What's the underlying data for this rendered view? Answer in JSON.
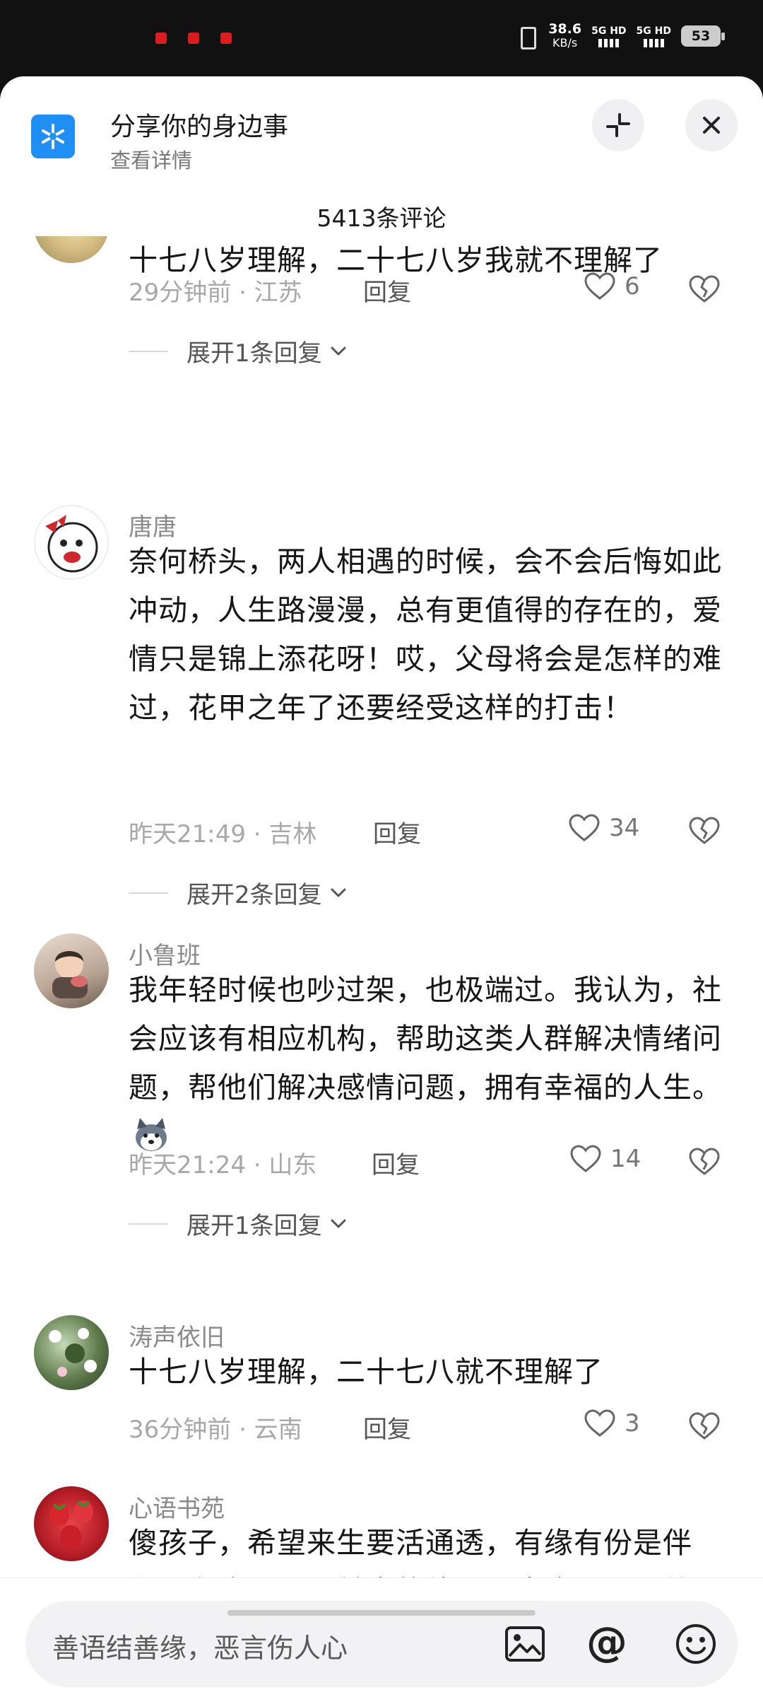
{
  "status_bar": {
    "speed": "38.6",
    "speed_unit": "KB/s",
    "sim1": "5G HD",
    "sim2": "5G HD",
    "battery": "53"
  },
  "header": {
    "topic_title": "分享你的身边事",
    "topic_sub": "查看详情",
    "comment_count": "5413条评论"
  },
  "comments": [
    {
      "username": "",
      "text": "十七八岁理解，二十七八岁我就不理解了",
      "meta": "29分钟前 · 江苏",
      "reply_label": "回复",
      "likes": "6",
      "expand_label": "展开1条回复"
    },
    {
      "username": "唐唐",
      "text": "奈何桥头，两人相遇的时候，会不会后悔如此冲动，人生路漫漫，总有更值得的存在的，爱情只是锦上添花呀！哎，父母将会是怎样的难过，花甲之年了还要经受这样的打击！",
      "meta": "昨天21:49 · 吉林",
      "reply_label": "回复",
      "likes": "34",
      "expand_label": "展开2条回复"
    },
    {
      "username": "小鲁班",
      "text": "我年轻时候也吵过架，也极端过。我认为，社会应该有相应机构，帮助这类人群解决情绪问题，帮他们解决感情问题，拥有幸福的人生。",
      "meta": "昨天21:24 · 山东",
      "reply_label": "回复",
      "likes": "14",
      "expand_label": "展开1条回复"
    },
    {
      "username": "涛声依旧",
      "text": "十七八岁理解，二十七八就不理解了",
      "meta": "36分钟前 · 云南",
      "reply_label": "回复",
      "likes": "3"
    },
    {
      "username": "心语书苑",
      "text": "傻孩子，希望来生要活通透，有缘有份是伴侣，有缘无分是前生的债，，，生命是父母给的，珍爱生命，是爱自己，也是为"
    }
  ],
  "bottom_bar": {
    "input_placeholder": "善语结善缘，恶言伤人心",
    "at_symbol": "@"
  },
  "colors": {
    "accent": "#1f8ff5",
    "text": "#161616",
    "muted": "#a8a8a8"
  }
}
